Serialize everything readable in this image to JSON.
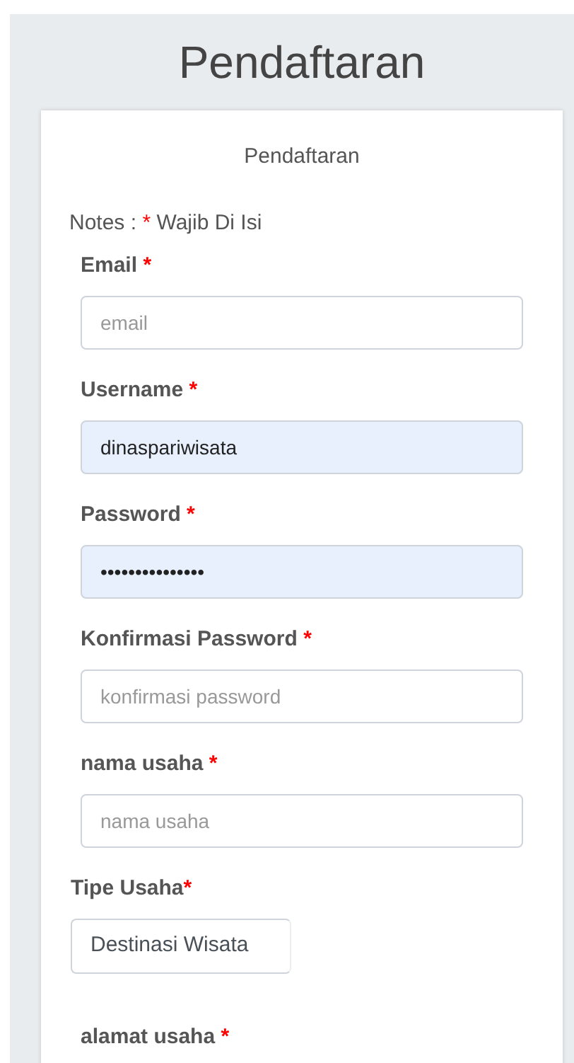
{
  "page_title": "Pendaftaran",
  "form": {
    "heading": "Pendaftaran",
    "notes": {
      "prefix": "Notes :",
      "mark": "*",
      "text": "Wajib Di Isi"
    },
    "fields": [
      {
        "kind": "input",
        "label": "Email",
        "mark": "*",
        "placeholder": "email",
        "autofilled": false
      },
      {
        "kind": "input",
        "label": "Username",
        "mark": "*",
        "value": "dinaspariwisata",
        "autofilled": true
      },
      {
        "kind": "input",
        "label": "Password",
        "mark": "*",
        "value": "•••••••••••••••",
        "autofilled": true
      },
      {
        "kind": "input",
        "label": "Konfirmasi Password",
        "mark": "*",
        "placeholder": "konfirmasi password",
        "autofilled": false
      },
      {
        "kind": "input",
        "label": "nama usaha",
        "mark": "*",
        "placeholder": "nama usaha",
        "autofilled": false
      },
      {
        "kind": "select",
        "label": "Tipe Usaha",
        "mark": "*",
        "value": "Destinasi Wisata"
      },
      {
        "kind": "heading",
        "label": "alamat usaha",
        "mark": "*"
      }
    ]
  }
}
